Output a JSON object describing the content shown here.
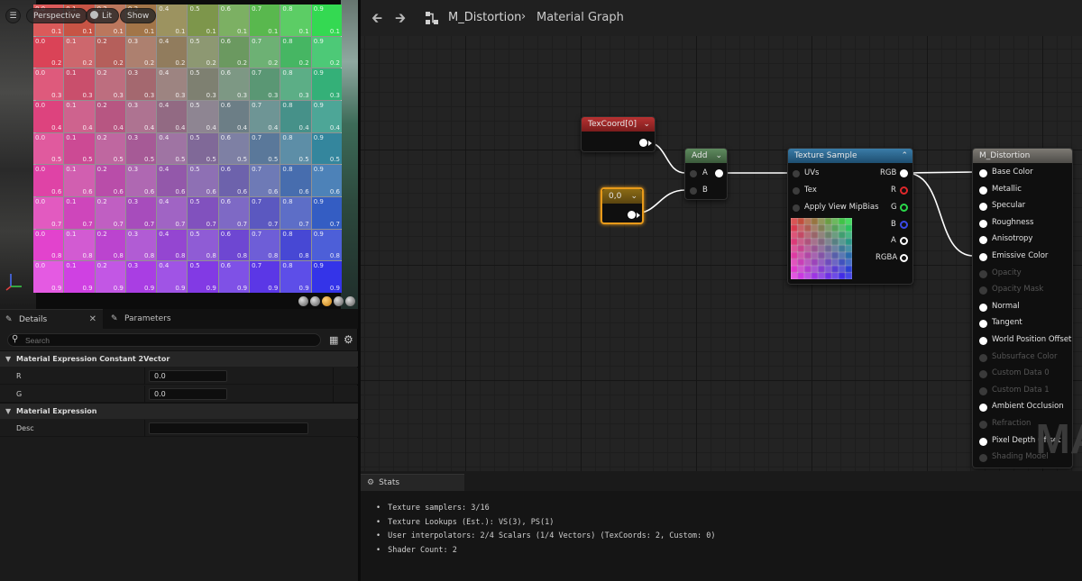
{
  "viewport": {
    "menu_icon": "hamburger-icon",
    "perspective_label": "Perspective",
    "lit_label": "Lit",
    "show_label": "Show",
    "checker_values": [
      "0.0",
      "0.1",
      "0.2",
      "0.3",
      "0.4",
      "0.5",
      "0.6",
      "0.7",
      "0.8",
      "0.9"
    ],
    "color_top_left": "#d83a3a",
    "color_top_right": "#2ad84a",
    "color_bottom_left": "#e23ae0",
    "color_bottom_right": "#2a2ae8"
  },
  "details": {
    "tab_details": "Details",
    "tab_parameters": "Parameters",
    "search_placeholder": "Search",
    "category_2vector": "Material Expression Constant 2Vector",
    "prop_r_label": "R",
    "prop_r_value": "0.0",
    "prop_g_label": "G",
    "prop_g_value": "0.0",
    "category_expression": "Material Expression",
    "prop_desc_label": "Desc",
    "prop_desc_value": ""
  },
  "graph": {
    "asset_name": "M_Distortion",
    "graph_name": "Material Graph",
    "watermark": "MA",
    "nodes": {
      "texcoord": {
        "title": "TexCoord[0]"
      },
      "constant": {
        "title": "0,0"
      },
      "add": {
        "title": "Add",
        "in_a": "A",
        "in_b": "B"
      },
      "texture_sample": {
        "title": "Texture Sample",
        "in_uvs": "UVs",
        "in_tex": "Tex",
        "in_mip": "Apply View MipBias",
        "out_rgb": "RGB",
        "out_r": "R",
        "out_g": "G",
        "out_b": "B",
        "out_a": "A",
        "out_rgba": "RGBA",
        "color_r": "#e0282b",
        "color_g": "#2ad84a",
        "color_b": "#3a4ae8"
      },
      "material": {
        "title": "M_Distortion",
        "inputs": [
          {
            "label": "Base Color",
            "enabled": true
          },
          {
            "label": "Metallic",
            "enabled": true
          },
          {
            "label": "Specular",
            "enabled": true
          },
          {
            "label": "Roughness",
            "enabled": true
          },
          {
            "label": "Anisotropy",
            "enabled": true
          },
          {
            "label": "Emissive Color",
            "enabled": true
          },
          {
            "label": "Opacity",
            "enabled": false
          },
          {
            "label": "Opacity Mask",
            "enabled": false
          },
          {
            "label": "Normal",
            "enabled": true
          },
          {
            "label": "Tangent",
            "enabled": true
          },
          {
            "label": "World Position Offset",
            "enabled": true
          },
          {
            "label": "Subsurface Color",
            "enabled": false
          },
          {
            "label": "Custom Data 0",
            "enabled": false
          },
          {
            "label": "Custom Data 1",
            "enabled": false
          },
          {
            "label": "Ambient Occlusion",
            "enabled": true
          },
          {
            "label": "Refraction",
            "enabled": false
          },
          {
            "label": "Pixel Depth Offset",
            "enabled": true
          },
          {
            "label": "Shading Model",
            "enabled": false
          }
        ]
      }
    }
  },
  "stats": {
    "tab_label": "Stats",
    "lines": [
      "Texture samplers: 3/16",
      "Texture Lookups (Est.): VS(3), PS(1)",
      "User interpolators: 2/4 Scalars (1/4 Vectors) (TexCoords: 2, Custom: 0)",
      "Shader Count: 2"
    ]
  }
}
